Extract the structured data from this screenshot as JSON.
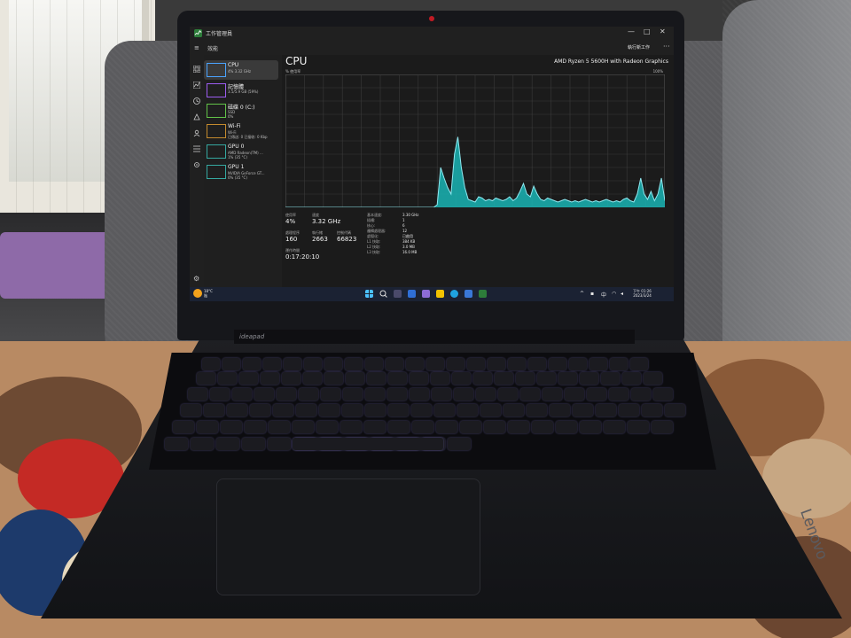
{
  "window": {
    "title": "工作管理員",
    "minimize_label": "—",
    "maximize_label": "□",
    "close_label": "✕"
  },
  "menubar": {
    "menu_icon": "≡",
    "page_label": "效能",
    "run_task_label": "執行新工作",
    "more_label": "···"
  },
  "sidebar": {
    "items": [
      {
        "name": "CPU",
        "sub": "4% 3.32 GHz",
        "sub2": "",
        "icon": "cpu-thumb",
        "color": "#4aa3ff"
      },
      {
        "name": "記憶體",
        "sub": "3.5/5.9 GB (59%)",
        "sub2": "",
        "icon": "memory-thumb",
        "color": "#9c5cf0"
      },
      {
        "name": "磁碟 0 (C:)",
        "sub": "SSD",
        "sub2": "0%",
        "icon": "disk-thumb",
        "color": "#62c248"
      },
      {
        "name": "Wi-Fi",
        "sub": "Wi-Fi",
        "sub2": "已傳送: 0 已接收: 0 Kbp",
        "icon": "wifi-thumb",
        "color": "#c48a2e"
      },
      {
        "name": "GPU 0",
        "sub": "AMD Radeon(TM) ...",
        "sub2": "1% (35 °C)",
        "icon": "gpu-thumb",
        "color": "#35a8a0"
      },
      {
        "name": "GPU 1",
        "sub": "NVIDIA GeForce GT...",
        "sub2": "0% (35 °C)",
        "icon": "gpu-thumb",
        "color": "#35a8a0"
      }
    ]
  },
  "cpu": {
    "title": "CPU",
    "model": "AMD Ryzen 5 5600H with Radeon Graphics",
    "chart_label": "% 使用率",
    "chart_max": "100%"
  },
  "stats": {
    "utilization_label": "使用率",
    "utilization": "4%",
    "speed_label": "速度",
    "speed": "3.32 GHz",
    "processes_label": "處理程序",
    "processes": "160",
    "threads_label": "執行緒",
    "threads": "2663",
    "handles_label": "控制代碼",
    "handles": "66823",
    "uptime_label": "運作時間",
    "uptime": "0:17:20:10"
  },
  "specs": [
    {
      "label": "基本速度:",
      "value": "3.30 GHz"
    },
    {
      "label": "插槽:",
      "value": "1"
    },
    {
      "label": "核心:",
      "value": "6"
    },
    {
      "label": "邏輯處理器:",
      "value": "12"
    },
    {
      "label": "虛擬化:",
      "value": "已啟用"
    },
    {
      "label": "L1 快取:",
      "value": "384 KB"
    },
    {
      "label": "L2 快取:",
      "value": "3.0 MB"
    },
    {
      "label": "L3 快取:",
      "value": "16.0 MB"
    }
  ],
  "taskbar": {
    "weather_temp": "18°C",
    "weather_text": "陰",
    "time": "下午 01:26",
    "date": "2023/3/24"
  },
  "laptop": {
    "brand": "Lenovo",
    "model_logo": "ideapad"
  },
  "colors": {
    "graph_fill": "#19b4b4",
    "graph_stroke": "#8fe8f0",
    "grid": "#5a5a5a",
    "screen_bg": "#1f1f1f",
    "key_glow": "#a59cff"
  },
  "chart_data": {
    "type": "area",
    "ylim": [
      0,
      100
    ],
    "values": [
      0,
      0,
      0,
      0,
      0,
      0,
      0,
      0,
      0,
      0,
      0,
      0,
      0,
      0,
      0,
      0,
      0,
      0,
      0,
      0,
      0,
      0,
      0,
      0,
      0,
      0,
      0,
      0,
      0,
      0,
      0,
      0,
      0,
      0,
      0,
      0,
      0,
      0,
      0,
      0,
      0,
      0,
      0,
      0,
      2,
      30,
      22,
      15,
      10,
      40,
      53,
      30,
      15,
      6,
      5,
      4,
      8,
      7,
      5,
      6,
      5,
      7,
      6,
      5,
      6,
      8,
      5,
      7,
      12,
      18,
      10,
      8,
      16,
      10,
      6,
      5,
      7,
      6,
      5,
      4,
      5,
      6,
      5,
      4,
      5,
      4,
      5,
      6,
      5,
      4,
      5,
      4,
      5,
      6,
      5,
      4,
      5,
      4,
      6,
      7,
      5,
      4,
      10,
      22,
      10,
      6,
      12,
      5,
      10,
      22,
      5
    ]
  }
}
